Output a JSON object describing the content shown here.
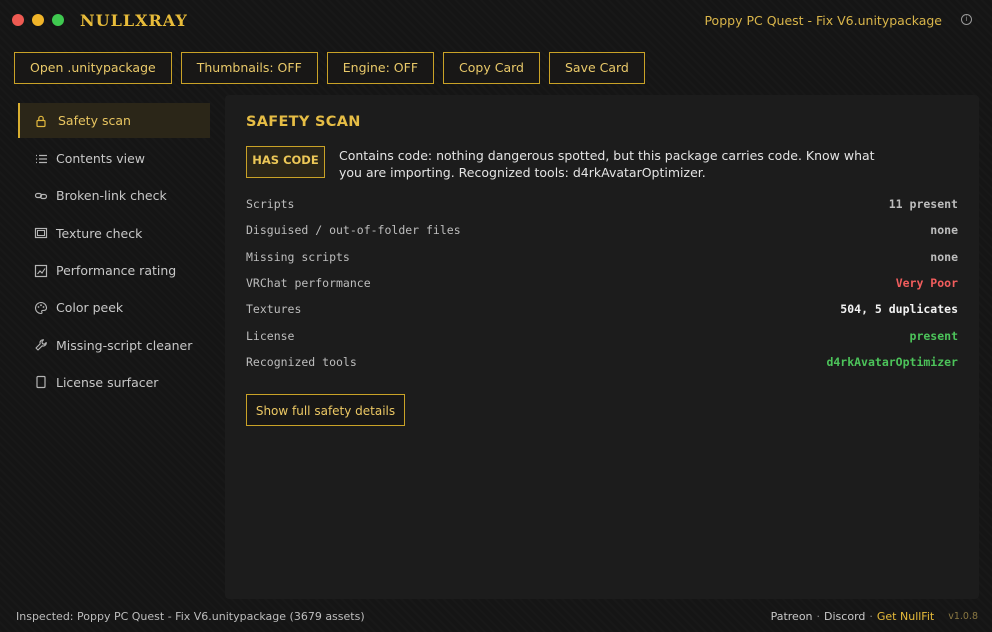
{
  "window": {
    "app_title": "NULLXRAY",
    "file_title": "Poppy PC Quest - Fix V6.unitypackage",
    "info_glyph": "i"
  },
  "toolbar": {
    "open_label": "Open .unitypackage",
    "thumbnails_label": "Thumbnails: OFF",
    "engine_label": "Engine: OFF",
    "copy_label": "Copy Card",
    "save_label": "Save Card"
  },
  "sidebar": {
    "items": [
      {
        "label": "Safety scan",
        "icon": "lock-icon"
      },
      {
        "label": "Contents view",
        "icon": "list-icon"
      },
      {
        "label": "Broken-link check",
        "icon": "link-icon"
      },
      {
        "label": "Texture check",
        "icon": "image-frame-icon"
      },
      {
        "label": "Performance rating",
        "icon": "chart-icon"
      },
      {
        "label": "Color peek",
        "icon": "palette-icon"
      },
      {
        "label": "Missing-script cleaner",
        "icon": "wrench-icon"
      },
      {
        "label": "License surfacer",
        "icon": "document-icon"
      }
    ]
  },
  "panel": {
    "title": "SAFETY SCAN",
    "badge": "HAS CODE",
    "summary": "Contains code: nothing dangerous spotted, but this package carries code. Know what you are importing. Recognized tools: d4rkAvatarOptimizer.",
    "rows": [
      {
        "key": "Scripts",
        "value": "11 present"
      },
      {
        "key": "Disguised / out-of-folder files",
        "value": "none"
      },
      {
        "key": "Missing scripts",
        "value": "none"
      },
      {
        "key": "VRChat performance",
        "value": "Very Poor"
      },
      {
        "key": "Textures",
        "value": "504, 5 duplicates"
      },
      {
        "key": "License",
        "value": "present"
      },
      {
        "key": "Recognized tools",
        "value": "d4rkAvatarOptimizer"
      }
    ],
    "details_label": "Show full safety details"
  },
  "status": {
    "inspected": "Inspected: Poppy PC Quest - Fix V6.unitypackage  (3679 assets)",
    "patreon": "Patreon",
    "discord": "Discord",
    "get_nullfit": "Get NullFit",
    "separator": "·",
    "version": "v1.0.8"
  },
  "colors": {
    "accent": "#e8bc3a",
    "danger": "#f25d5d",
    "success": "#4cc35a"
  }
}
